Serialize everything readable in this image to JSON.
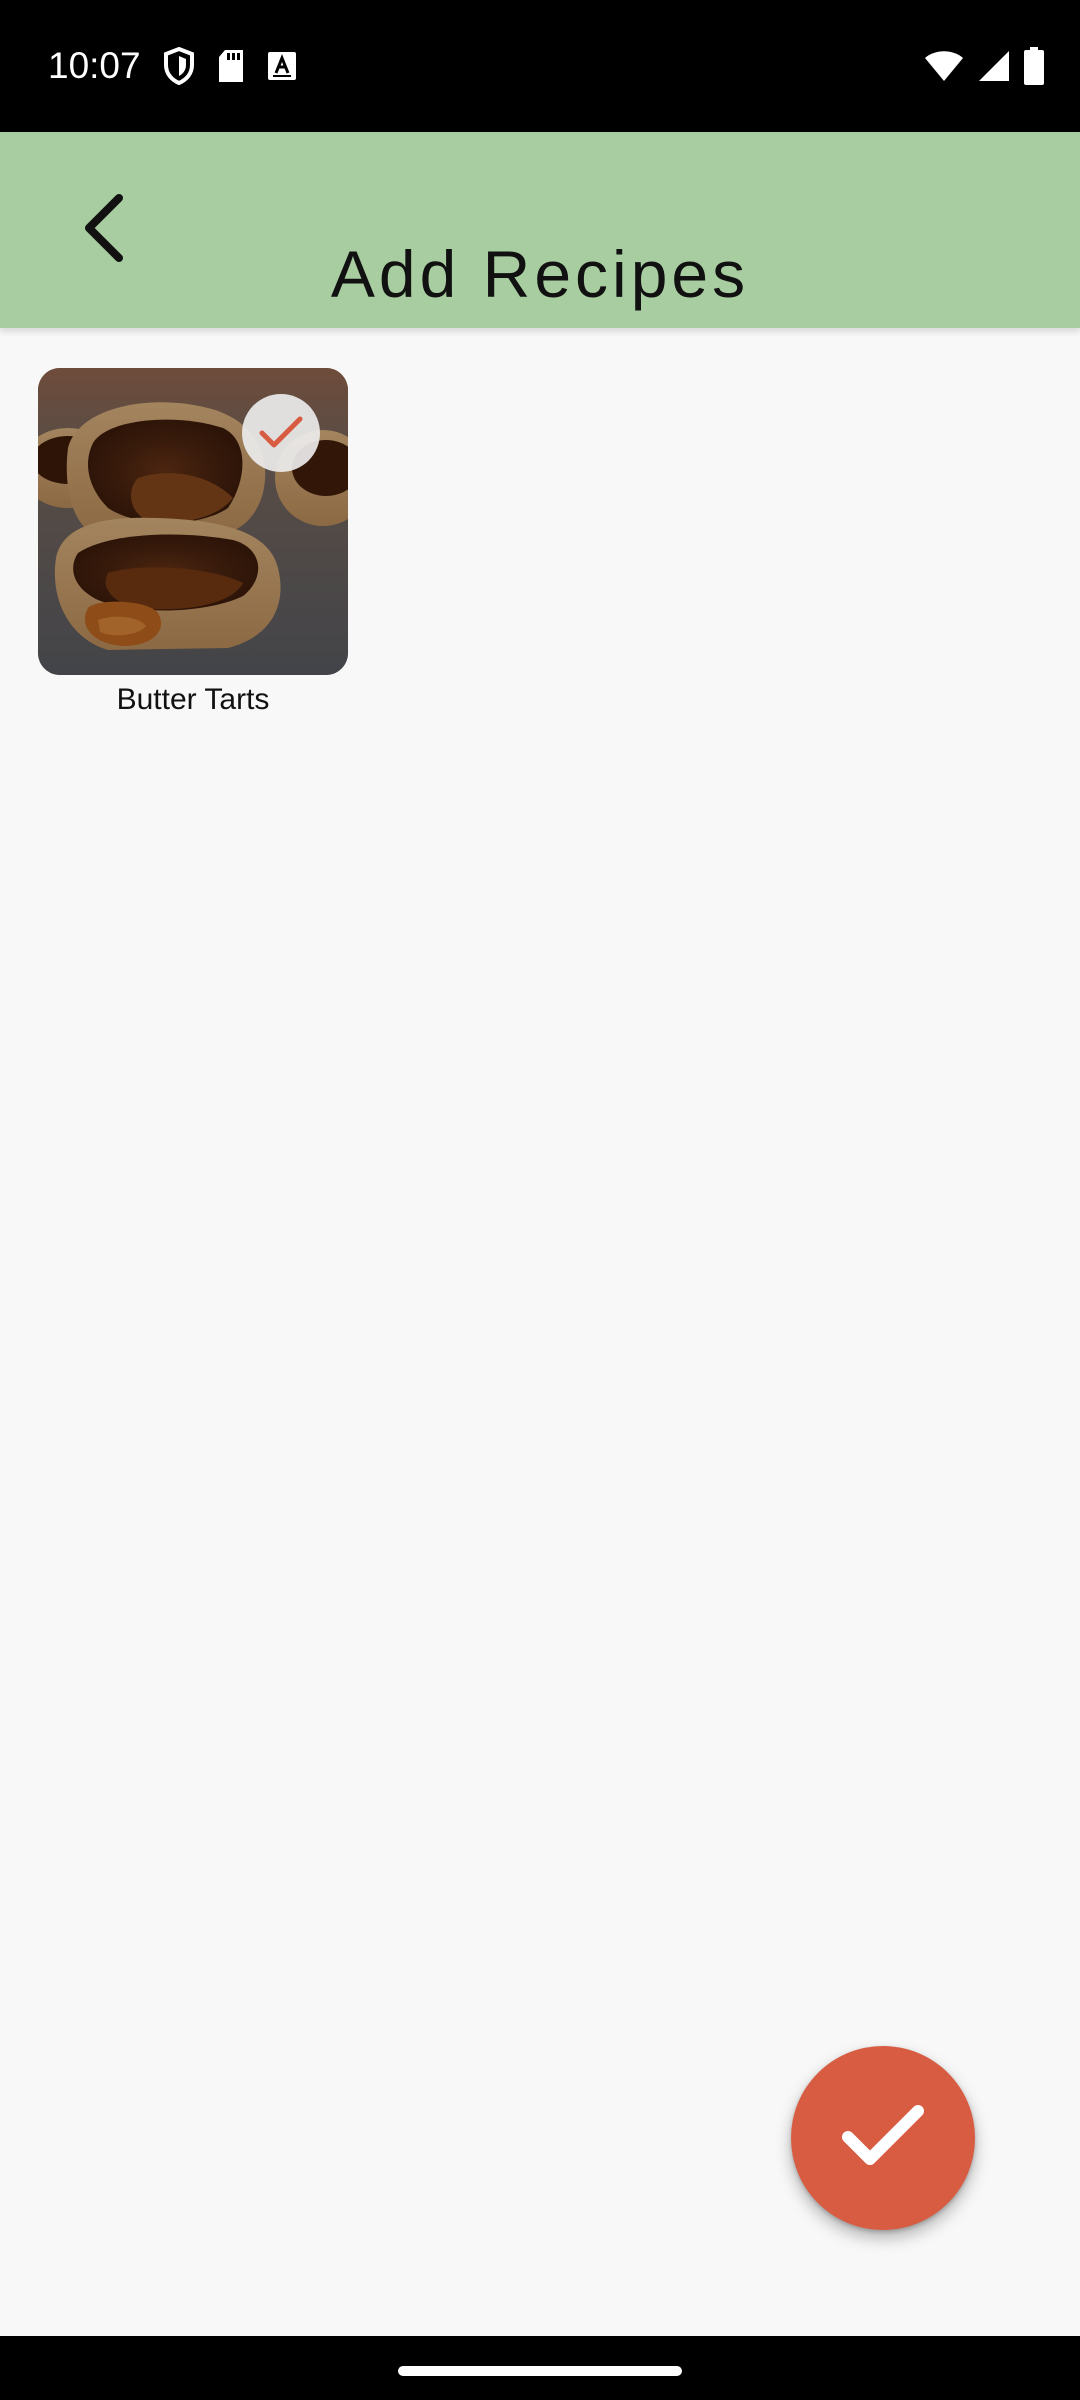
{
  "status_bar": {
    "time": "10:07",
    "left_icons": [
      "shield-icon",
      "sd-card-icon",
      "keyboard-a-icon"
    ],
    "right_icons": [
      "wifi-icon",
      "cell-signal-icon",
      "battery-icon"
    ]
  },
  "app_bar": {
    "title": "Add Recipes",
    "back_icon": "chevron-left-icon",
    "background": "#a8cda0"
  },
  "recipes": [
    {
      "name": "Butter Tarts",
      "selected": true,
      "selected_icon": "check-icon"
    }
  ],
  "fab": {
    "icon": "check-icon",
    "color": "#d85c42"
  },
  "colors": {
    "accent": "#d85c42",
    "app_bar": "#a8cda0",
    "background": "#f8f8f8"
  }
}
